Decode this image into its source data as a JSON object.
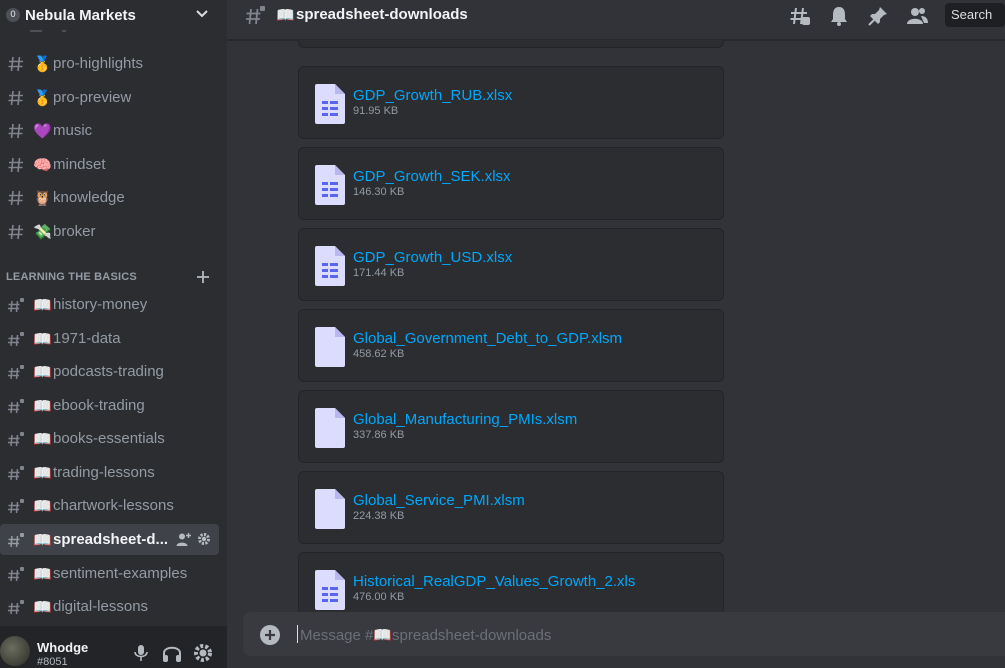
{
  "server": {
    "badge": "0",
    "name": "Nebula Markets"
  },
  "channels_top": [
    {
      "emoji": "🥇",
      "name": "pro-highlights"
    },
    {
      "emoji": "🥇",
      "name": "pro-preview"
    },
    {
      "emoji": "💜",
      "name": "music"
    },
    {
      "emoji": "🧠",
      "name": "mindset"
    },
    {
      "emoji": "🦉",
      "name": "knowledge"
    },
    {
      "emoji": "💸",
      "name": "broker"
    }
  ],
  "category": {
    "label": "LEARNING THE BASICS"
  },
  "channels_basics": [
    {
      "emoji": "📖",
      "name": "history-money"
    },
    {
      "emoji": "📖",
      "name": "1971-data"
    },
    {
      "emoji": "📖",
      "name": "podcasts-trading"
    },
    {
      "emoji": "📖",
      "name": "ebook-trading"
    },
    {
      "emoji": "📖",
      "name": "books-essentials"
    },
    {
      "emoji": "📖",
      "name": "trading-lessons"
    },
    {
      "emoji": "📖",
      "name": "chartwork-lessons"
    },
    {
      "emoji": "📖",
      "name": "spreadsheet-d..."
    },
    {
      "emoji": "📖",
      "name": "sentiment-examples"
    },
    {
      "emoji": "📖",
      "name": "digital-lessons"
    }
  ],
  "user": {
    "name": "Whodge",
    "tag": "#8051"
  },
  "header": {
    "emoji": "📖",
    "title": "spreadsheet-downloads",
    "search": "Search"
  },
  "files": [
    {
      "name": "GDP_Growth_RUB.xlsx",
      "size": "91.95 KB",
      "kind": "sheet"
    },
    {
      "name": "GDP_Growth_SEK.xlsx",
      "size": "146.30 KB",
      "kind": "sheet"
    },
    {
      "name": "GDP_Growth_USD.xlsx",
      "size": "171.44 KB",
      "kind": "sheet"
    },
    {
      "name": "Global_Government_Debt_to_GDP.xlsm",
      "size": "458.62 KB",
      "kind": "doc"
    },
    {
      "name": "Global_Manufacturing_PMIs.xlsm",
      "size": "337.86 KB",
      "kind": "doc"
    },
    {
      "name": "Global_Service_PMI.xlsm",
      "size": "224.38 KB",
      "kind": "doc"
    },
    {
      "name": "Historical_RealGDP_Values_Growth_2.xls",
      "size": "476.00 KB",
      "kind": "sheet"
    }
  ],
  "composer": {
    "placeholder": "Message #📖spreadsheet-downloads"
  },
  "colors": {
    "link": "#00a8fc",
    "sidebar": "#2b2d31",
    "main": "#313338"
  }
}
